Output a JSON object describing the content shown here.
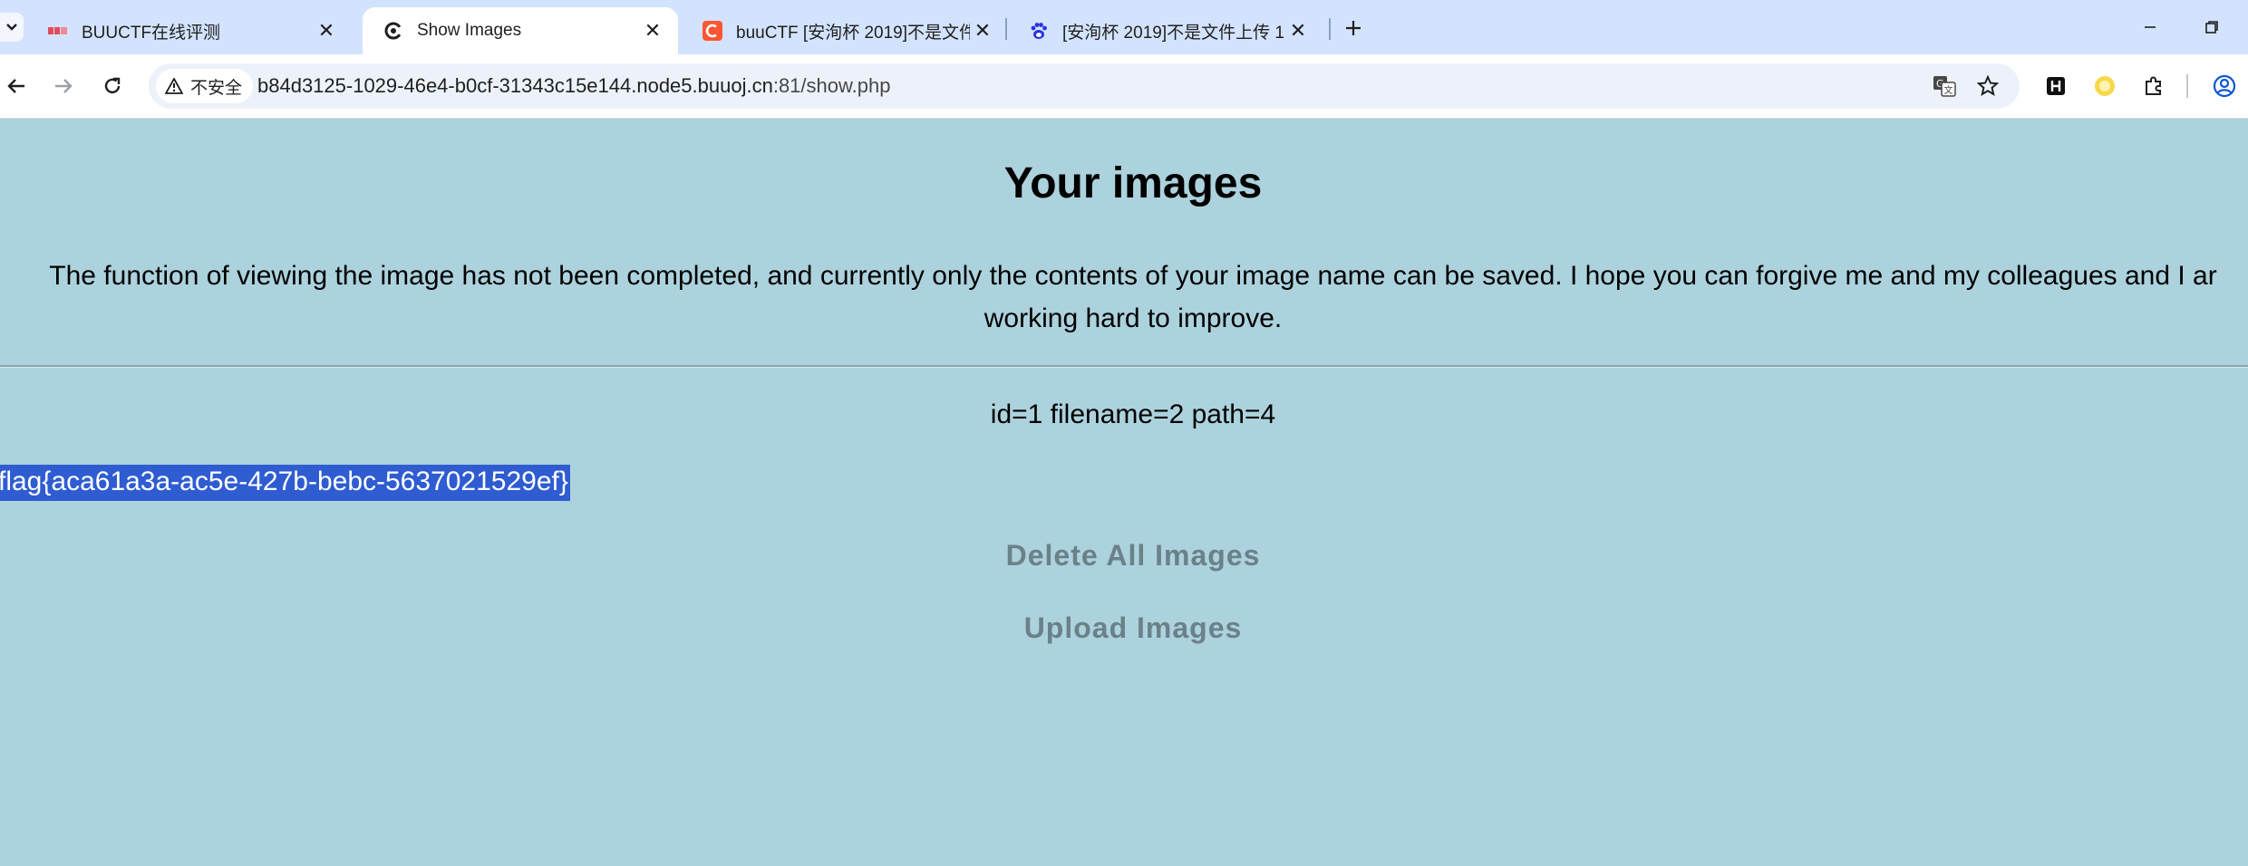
{
  "tabs": [
    {
      "title": "BUUCTF在线评测",
      "icon": "buuctf-icon",
      "active": false
    },
    {
      "title": "Show Images",
      "icon": "site-icon",
      "active": true
    },
    {
      "title": "buuCTF [安洵杯 2019]不是文件",
      "icon": "csdn-icon",
      "active": false
    },
    {
      "title": "[安洵杯 2019]不是文件上传 1",
      "icon": "baidu-paw-icon",
      "active": false
    }
  ],
  "toolbar": {
    "security_label": "不安全",
    "url_host": "b84d3125-1029-46e4-b0cf-31343c15e144.node5.buuoj.cn",
    "url_path": ":81/show.php"
  },
  "page": {
    "heading": "Your images",
    "description_line1": "The function of viewing the image has not been completed, and currently only the contents of your image name can be saved. I hope you can forgive me and my colleagues and I ar",
    "description_line2": "working hard to improve.",
    "ids_line": "id=1 filename=2 path=4",
    "flag_text": "flag{aca61a3a-ac5e-427b-bebc-5637021529ef}",
    "delete_label": "Delete All Images",
    "upload_label": "Upload Images"
  },
  "colors": {
    "page_background": "#acd2dd",
    "selection": "#2f5cd1",
    "action_text": "#6b8189",
    "tabstrip": "#d3e3fd"
  }
}
